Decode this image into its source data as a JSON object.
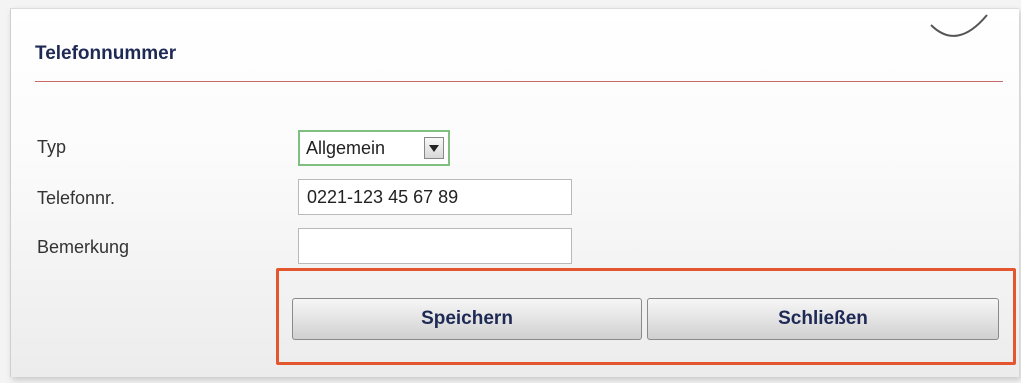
{
  "dialog": {
    "title": "Telefonnummer"
  },
  "form": {
    "type_label": "Typ",
    "type_value": "Allgemein",
    "phone_label": "Telefonnr.",
    "phone_value": "0221-123 45 67 89",
    "remark_label": "Bemerkung",
    "remark_value": ""
  },
  "buttons": {
    "save_label": "Speichern",
    "close_label": "Schließen"
  },
  "colors": {
    "title_text": "#1e2a55",
    "title_rule": "#c96a6a",
    "select_border": "#7fbf7f",
    "highlight_frame": "#e4572e"
  },
  "icons": {
    "select_arrow": "chevron-down-icon"
  }
}
